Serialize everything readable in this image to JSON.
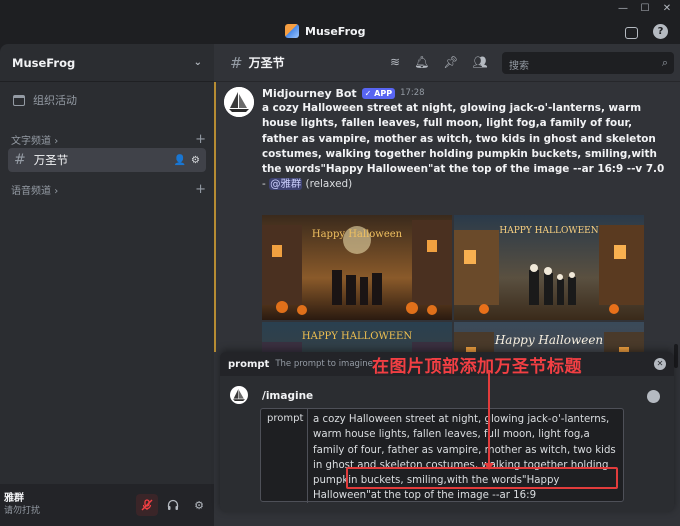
{
  "window": {
    "title": "MuseFrog",
    "controls": [
      "—",
      "☐",
      "✕"
    ]
  },
  "sidebar": {
    "server_name": "MuseFrog",
    "events_label": "组织活动",
    "text_category": "文字频道",
    "active_channel": "万圣节",
    "voice_category": "语音频道"
  },
  "user": {
    "name": "雅群",
    "status": "请勿打扰"
  },
  "header": {
    "channel": "万圣节",
    "search_placeholder": "搜索"
  },
  "message": {
    "author": "Midjourney Bot",
    "badge": "APP",
    "time": "17:28",
    "prompt_text": "a cozy Halloween street at night, glowing jack-o'-lanterns, warm house lights, fallen leaves, full moon, light fog,a family of four, father as vampire, mother as witch, two kids in ghost and skeleton costumes, walking together holding pumpkin buckets, smiling,with the words\"Happy Halloween\"at the top of the image --ar 16:9 --v 7.0",
    "mention": "@雅群",
    "suffix": "(relaxed)",
    "images": [
      {
        "caption": "Happy Halloween"
      },
      {
        "caption": "HAPPY HALLOWEEN"
      },
      {
        "caption": "HAPPY HALLOWEEN"
      },
      {
        "caption": "Happy Halloween"
      }
    ]
  },
  "command": {
    "option_name": "prompt",
    "option_desc": "The prompt to imagine",
    "name": "/imagine",
    "field_label": "prompt",
    "field_value": "a cozy Halloween street at night, glowing jack-o'-lanterns, warm house lights, fallen leaves, full moon, light fog,a family of four, father as vampire, mother as witch, two kids in ghost and skeleton costumes, walking together holding pumpkin buckets, smiling,with the words\"Happy Halloween\"at the top of the image --ar 16:9"
  },
  "annotation": {
    "text": "在图片顶部添加万圣节标题"
  },
  "colors": {
    "accent": "#5865f2",
    "annotation_red": "#e23c3c"
  }
}
